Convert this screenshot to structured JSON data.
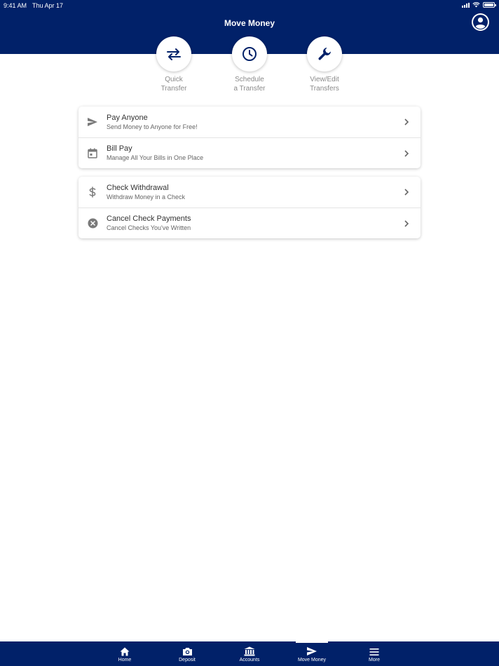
{
  "status": {
    "time": "9:41 AM",
    "date": "Thu Apr 17"
  },
  "header": {
    "title": "Move Money"
  },
  "colors": {
    "brand": "#012169",
    "icon_gray": "#7a7a7a"
  },
  "quick_actions": [
    {
      "line1": "Quick",
      "line2": "Transfer",
      "icon": "swap-arrows-icon"
    },
    {
      "line1": "Schedule",
      "line2": "a Transfer",
      "icon": "clock-icon"
    },
    {
      "line1": "View/Edit",
      "line2": "Transfers",
      "icon": "wrench-icon"
    }
  ],
  "payments": [
    {
      "title": "Pay Anyone",
      "subtitle": "Send Money to Anyone for Free!",
      "icon": "send-icon"
    },
    {
      "title": "Bill Pay",
      "subtitle": "Manage All Your Bills in One Place",
      "icon": "calendar-icon"
    }
  ],
  "checks": [
    {
      "title": "Check Withdrawal",
      "subtitle": "Withdraw Money in a Check",
      "icon": "dollar-icon"
    },
    {
      "title": "Cancel Check Payments",
      "subtitle": "Cancel Checks You've Written",
      "icon": "cancel-circle-icon"
    }
  ],
  "tabs": [
    {
      "label": "Home",
      "icon": "home-icon"
    },
    {
      "label": "Deposit",
      "icon": "camera-icon"
    },
    {
      "label": "Accounts",
      "icon": "bank-icon"
    },
    {
      "label": "Move Money",
      "icon": "send-icon",
      "active": true
    },
    {
      "label": "More",
      "icon": "menu-icon"
    }
  ]
}
